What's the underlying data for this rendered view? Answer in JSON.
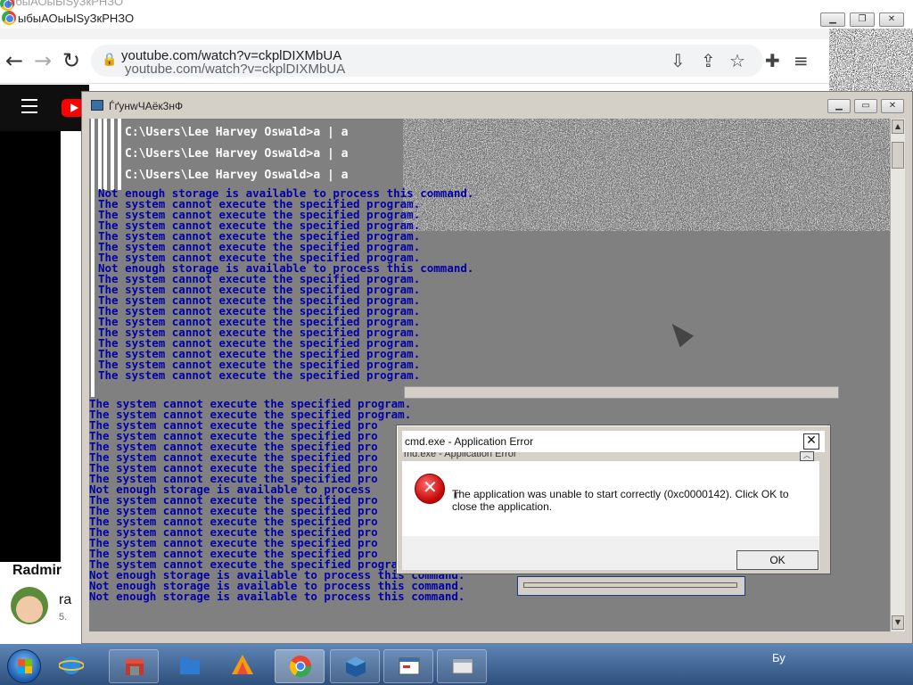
{
  "browser": {
    "title_ghost": "ыбыАОыЫSуЗкРНЗО",
    "title": "ыбыАОыЫSуЗкРНЗО",
    "url": "youtube.com/watch?v=ckplDIXMbUA",
    "url_ghost": "youtube.com/watch?v=ckplDIXMbUA",
    "channel_name": "Radmir",
    "channel_sub": "ra",
    "channel_count": "5."
  },
  "cmd": {
    "title": "ЃґунwЧАёк3нФ",
    "prompts": [
      "C:\\Users\\Lee Harvey Oswald>a | a",
      "C:\\Users\\Lee Harvey Oswald>a | a",
      "C:\\Users\\Lee Harvey Oswald>a | a"
    ],
    "lines_upper": [
      "Not enough storage is available to process this command.",
      "The system cannot execute the specified program.",
      "The system cannot execute the specified program.",
      "The system cannot execute the specified program.",
      "The system cannot execute the specified program.",
      "The system cannot execute the specified program.",
      "The system cannot execute the specified program.",
      "Not enough storage is available to process this command.",
      "The system cannot execute the specified program.",
      "The system cannot execute the specified program.",
      "The system cannot execute the specified program.",
      "The system cannot execute the specified program.",
      "The system cannot execute the specified program.",
      "The system cannot execute the specified program.",
      "The system cannot execute the specified program.",
      "The system cannot execute the specified program.",
      "The system cannot execute the specified program.",
      "The system cannot execute the specified program."
    ],
    "lines_lower": [
      "The system cannot execute the specified program.",
      "The system cannot execute the specified program.",
      "The system cannot execute the specified pro",
      "The system cannot execute the specified pro",
      "The system cannot execute the specified pro",
      "The system cannot execute the specified pro",
      "The system cannot execute the specified pro",
      "The system cannot execute the specified pro",
      "Not enough storage is available to process",
      "The system cannot execute the specified pro",
      "The system cannot execute the specified pro",
      "The system cannot execute the specified pro",
      "The system cannot execute the specified pro",
      "The system cannot execute the specified pro",
      "The system cannot execute the specified pro",
      "The system cannot execute the specified program.",
      "Not enough storage is available to process this command.",
      "Not enough storage is available to process this command.",
      "Not enough storage is available to process this command."
    ]
  },
  "error_dialog": {
    "title": "cmd.exe - Application Error",
    "ghost_title": "md.exe - Application Error",
    "glyph": "╓",
    "message": "The application was unable to start correctly (0xc0000142). Click OK to close the application.",
    "ok_label": "OK",
    "close_symbol": "✕"
  },
  "taskbar": {
    "clock_fragment": "Бу"
  },
  "colors": {
    "console_bg": "#808080",
    "console_text": "#0000a8",
    "taskbar": "#3d6494"
  }
}
